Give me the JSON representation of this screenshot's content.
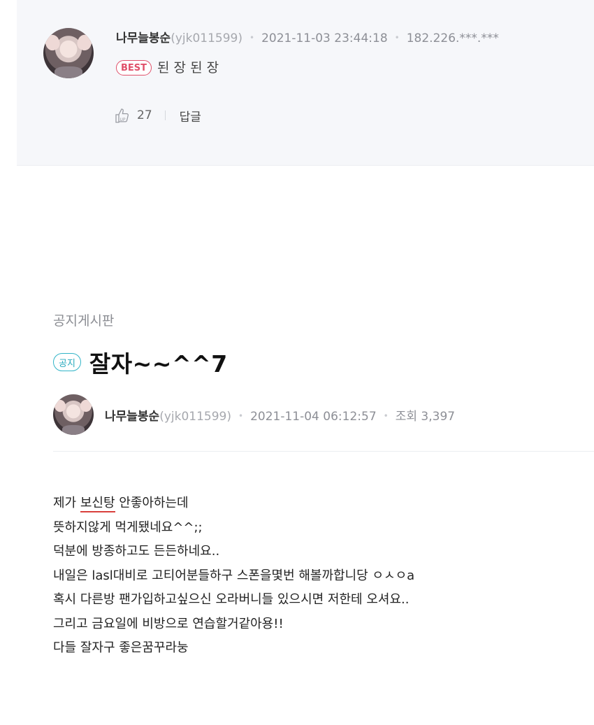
{
  "comment": {
    "nickname": "나무늘봉순",
    "user_id": "(yjk011599)",
    "datetime": "2021-11-03 23:44:18",
    "ip": "182.226.***.***",
    "badge": "BEST",
    "text": "된 장 된 장",
    "up_icon": "thumbs-up-icon",
    "up_count": "27",
    "reply_label": "답글"
  },
  "post": {
    "board_name": "공지게시판",
    "notice_badge": "공지",
    "title": "잘자~~^^7",
    "nickname": "나무늘봉순",
    "user_id": "(yjk011599)",
    "datetime": "2021-11-04 06:12:57",
    "views_label": "조회",
    "views": "3,397",
    "content_lines": [
      "제가 보신탕 안좋아하는데",
      "뜻하지않게 먹게됐네요^^;;",
      "덕분에 방종하고도 든든하네요..",
      "내일은 lasl대비로 고티어분들하구 스폰을몇번 해볼까합니당 ㅇㅅㅇa",
      "혹시 다른방 팬가입하고싶으신 오라버니들 있으시면 저한테 오셔요..",
      "그리고 금요일에 비방으로 연습할거같아용!!",
      "다들 잘자구 좋은꿈꾸라눙"
    ]
  },
  "colors": {
    "best": "#e0506a",
    "notice": "#33b5c8",
    "comment_bg": "#f6f7fa"
  }
}
